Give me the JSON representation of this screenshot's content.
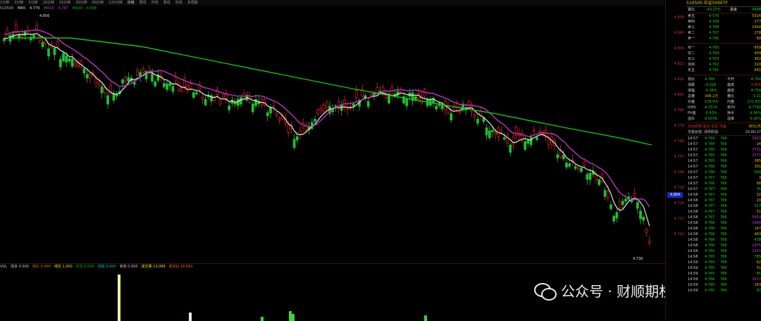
{
  "toolbar": {
    "items": [
      "1分钟",
      "3分钟",
      "5分钟",
      "10分钟",
      "15分钟",
      "30分钟",
      "60分钟",
      "120分钟",
      "日线",
      "周线",
      "月线",
      "季线",
      "年线",
      "多周期"
    ],
    "active": "日线"
  },
  "legend": {
    "code": "510500",
    "items": [
      {
        "text": "MA5",
        "value": "4.779",
        "color": "#e0e0e0"
      },
      {
        "text": "MA10",
        "value": "4.787",
        "color": "#c040c0"
      },
      {
        "text": "MA30",
        "value": "4.808",
        "color": "#00c000"
      }
    ]
  },
  "annotations": {
    "high_label": "4.856",
    "low_label": "4.739"
  },
  "price_axis": {
    "ticks": [
      "4.856",
      "4.845",
      "4.834",
      "4.823",
      "4.812",
      "4.801",
      "4.790",
      "4.779",
      "4.768",
      "4.757",
      "4.746",
      "4.735",
      "4.724",
      "4.713",
      "4.702"
    ],
    "current": "4.804"
  },
  "panel": {
    "title": "510500 中证500ETF",
    "weibi": {
      "label": "委比",
      "value": "-43.27%",
      "label2": "委差",
      "value2": "-4698"
    },
    "asks": [
      {
        "label": "卖五",
        "price": "4.770",
        "vol": "5014"
      },
      {
        "label": "卖四",
        "price": "4.769",
        "vol": "277"
      },
      {
        "label": "卖三",
        "price": "4.768",
        "vol": "1640"
      },
      {
        "label": "卖二",
        "price": "4.767",
        "vol": "278"
      },
      {
        "label": "卖一",
        "price": "4.766",
        "vol": "69"
      }
    ],
    "bids": [
      {
        "label": "买一",
        "price": "4.765",
        "vol": "659"
      },
      {
        "label": "买二",
        "price": "4.764",
        "vol": "409"
      },
      {
        "label": "买三",
        "price": "4.763",
        "vol": "952"
      },
      {
        "label": "买四",
        "price": "4.762",
        "vol": "320"
      },
      {
        "label": "买五",
        "price": "4.761",
        "vol": "691"
      }
    ],
    "quote": [
      {
        "l1": "现价",
        "v1": "4.765",
        "l2": "今开",
        "v2": "4.750"
      },
      {
        "l1": "涨跌",
        "v1": "-0.018",
        "l2": "最高",
        "v2": "4.856"
      },
      {
        "l1": "涨幅",
        "v1": "-0.38%",
        "l2": "最低",
        "v2": "4.739"
      },
      {
        "l1": "总量",
        "v1": "348.2万",
        "l2": "量比",
        "v2": "1.21"
      },
      {
        "l1": "外盘",
        "v1": "176.4万",
        "l2": "内盘",
        "v2": "171.8万"
      },
      {
        "l1": "IOPV",
        "v1": "4.7574",
        "l2": "折PV",
        "v2": "4.7780"
      },
      {
        "l1": "PV值",
        "v1": "-0.43%",
        "l2": "换手",
        "v2": "4.36%"
      },
      {
        "l1": "溢价",
        "v1": "0.0078",
        "l2": "溢率",
        "v2": "0.16%"
      }
    ],
    "status1": "自动结算 退出 信息 页面",
    "status1b": "38元/月",
    "status2": "交易状态: 闭市阶段",
    "status2b": "15:00:17",
    "ticks": [
      {
        "t": "14:57",
        "p": "4.764",
        "v": "766",
        "n": "3953"
      },
      {
        "t": "14:57",
        "p": "4.764",
        "v": "766",
        "n": "24"
      },
      {
        "t": "14:57",
        "p": "4.765",
        "v": "766",
        "n": "3731"
      },
      {
        "t": "14:57",
        "p": "4.765",
        "v": "766",
        "n": "2570"
      },
      {
        "t": "14:57",
        "p": "4.765",
        "v": "766",
        "n": "385"
      },
      {
        "t": "14:57",
        "p": "4.766",
        "v": "766",
        "n": "391"
      },
      {
        "t": "14:57",
        "p": "4.766",
        "v": "766",
        "n": "500"
      },
      {
        "t": "14:57",
        "p": "4.767",
        "v": "766",
        "n": "3"
      },
      {
        "t": "14:57",
        "p": "4.766",
        "v": "766",
        "n": "68"
      },
      {
        "t": "14:57",
        "p": "4.767",
        "v": "766",
        "n": "35"
      },
      {
        "t": "14:58",
        "p": "4.767",
        "v": "766",
        "n": "32"
      },
      {
        "t": "14:58",
        "p": "4.767",
        "v": "766",
        "n": "20"
      },
      {
        "t": "14:58",
        "p": "4.767",
        "v": "766",
        "n": "317"
      },
      {
        "t": "14:58",
        "p": "4.767",
        "v": "766",
        "n": "51"
      },
      {
        "t": "14:58",
        "p": "4.767",
        "v": "766",
        "n": "5853"
      },
      {
        "t": "14:58",
        "p": "4.766",
        "v": "766",
        "n": "1888"
      },
      {
        "t": "14:58",
        "p": "4.766",
        "v": "766",
        "n": "147"
      },
      {
        "t": "14:58",
        "p": "4.766",
        "v": "766",
        "n": "483"
      },
      {
        "t": "14:58",
        "p": "4.766",
        "v": "766",
        "n": "438"
      },
      {
        "t": "14:58",
        "p": "4.766",
        "v": "766",
        "n": "2975"
      },
      {
        "t": "14:58",
        "p": "4.765",
        "v": "766",
        "n": "2341"
      },
      {
        "t": "14:58",
        "p": "4.765",
        "v": "766",
        "n": "785"
      },
      {
        "t": "14:59",
        "p": "4.765",
        "v": "766",
        "n": "62"
      },
      {
        "t": "14:59",
        "p": "4.765",
        "v": "766",
        "n": "51"
      },
      {
        "t": "14:59",
        "p": "4.765",
        "v": "766",
        "n": "85"
      },
      {
        "t": "14:59",
        "p": "4.766",
        "v": "766",
        "n": "3527"
      },
      {
        "t": "14:59",
        "p": "4.765",
        "v": "766",
        "n": "283"
      },
      {
        "t": "14:59",
        "p": "4.765",
        "v": "766",
        "n": "97"
      }
    ]
  },
  "volume_legend": {
    "items": [
      {
        "text": "VOL",
        "color": "#c8c8c8"
      },
      {
        "text": "绿多 0.000",
        "color": "#c8c8c8"
      },
      {
        "text": "绿头 0.000",
        "color": "#e07020"
      },
      {
        "text": "绿空 1.000",
        "color": "#e0e000"
      },
      {
        "text": "红空 0.000",
        "color": "#00c000"
      },
      {
        "text": "绿有 0.000",
        "color": "#00c0c0"
      },
      {
        "text": "有效 0.000",
        "color": "#c8c8c8"
      },
      {
        "text": "成交量 13.089",
        "color": "#e0e000"
      },
      {
        "text": "成交比 16.691",
        "color": "#e07020"
      }
    ]
  },
  "watermark": {
    "text": "公众号 · 财顺期权"
  },
  "colors": {
    "up": "#e02020",
    "down": "#20c030",
    "ma5": "#e8e8e8",
    "ma10": "#c030c0",
    "ma30": "#18c018"
  }
}
